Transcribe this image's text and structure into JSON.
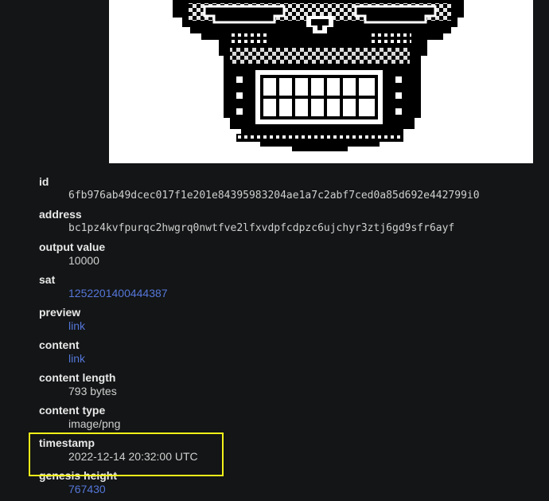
{
  "inscription": {
    "image_alt_icon": "sugar-skull-pixel-art",
    "fields": {
      "id": {
        "label": "id",
        "value": "6fb976ab49dcec017f1e201e84395983204ae1a7c2abf7ced0a85d692e442799i0"
      },
      "address": {
        "label": "address",
        "value": "bc1pz4kvfpurqc2hwgrq0nwtfve2lfxvdpfcdpzc6ujchyr3ztj6gd9sfr6ayf"
      },
      "output_value": {
        "label": "output value",
        "value": "10000"
      },
      "sat": {
        "label": "sat",
        "value": "1252201400444387"
      },
      "preview": {
        "label": "preview",
        "value": "link"
      },
      "content": {
        "label": "content",
        "value": "link"
      },
      "content_length": {
        "label": "content length",
        "value": "793 bytes"
      },
      "content_type": {
        "label": "content type",
        "value": "image/png"
      },
      "timestamp": {
        "label": "timestamp",
        "value": "2022-12-14 20:32:00 UTC"
      },
      "genesis_height": {
        "label": "genesis height",
        "value": "767430"
      }
    }
  },
  "colors": {
    "background": "#131516",
    "link": "#5576d8",
    "highlight": "#f3f319"
  }
}
